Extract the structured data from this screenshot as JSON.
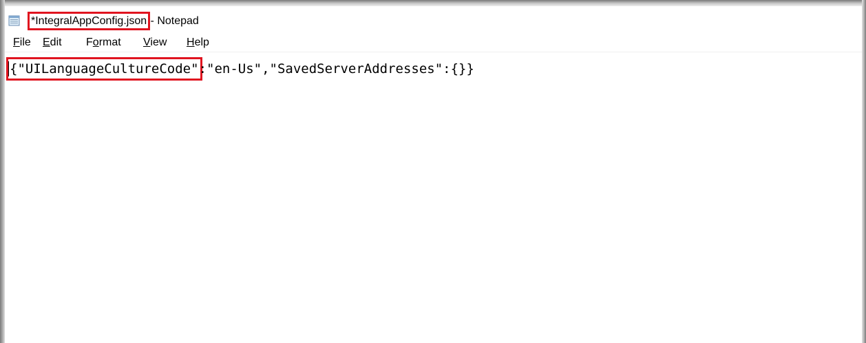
{
  "window": {
    "title_filename": "*IntegralAppConfig.json",
    "title_separator": " - ",
    "title_appname": "Notepad",
    "icon": "notepad-icon"
  },
  "menubar": {
    "items": [
      {
        "label": "File",
        "mnemonic": "F",
        "rest": "ile"
      },
      {
        "label": "Edit",
        "mnemonic": "E",
        "rest": "dit"
      },
      {
        "label": "Format",
        "mnemonic": "o",
        "pre": "F",
        "rest": "rmat"
      },
      {
        "label": "View",
        "mnemonic": "V",
        "rest": "iew"
      },
      {
        "label": "Help",
        "mnemonic": "H",
        "rest": "elp"
      }
    ]
  },
  "editor": {
    "open_brace": "{",
    "highlighted_key": "\"UILanguageCultureCode\"",
    "rest_of_line": ":\"en-Us\",\"SavedServerAddresses\":{}}"
  },
  "annotations": {
    "highlight_color": "#e0141f"
  }
}
